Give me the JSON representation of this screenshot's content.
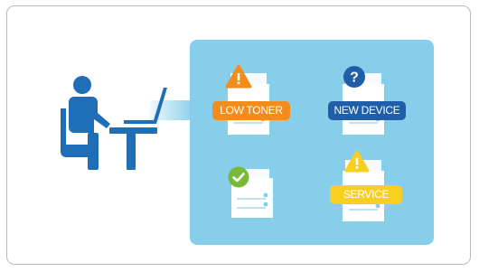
{
  "badges": {
    "low_toner": "LOW TONER",
    "new_device": "NEW DEVICE",
    "service": "SERVICE"
  },
  "icons": {
    "question_glyph": "?",
    "warning_glyph": "!"
  },
  "colors": {
    "panel": "#87ceeb",
    "person": "#1f6fb8",
    "warning": "#f28c1a",
    "info": "#1f5ea8",
    "ok": "#7ab83a",
    "service": "#f7cf1e"
  }
}
